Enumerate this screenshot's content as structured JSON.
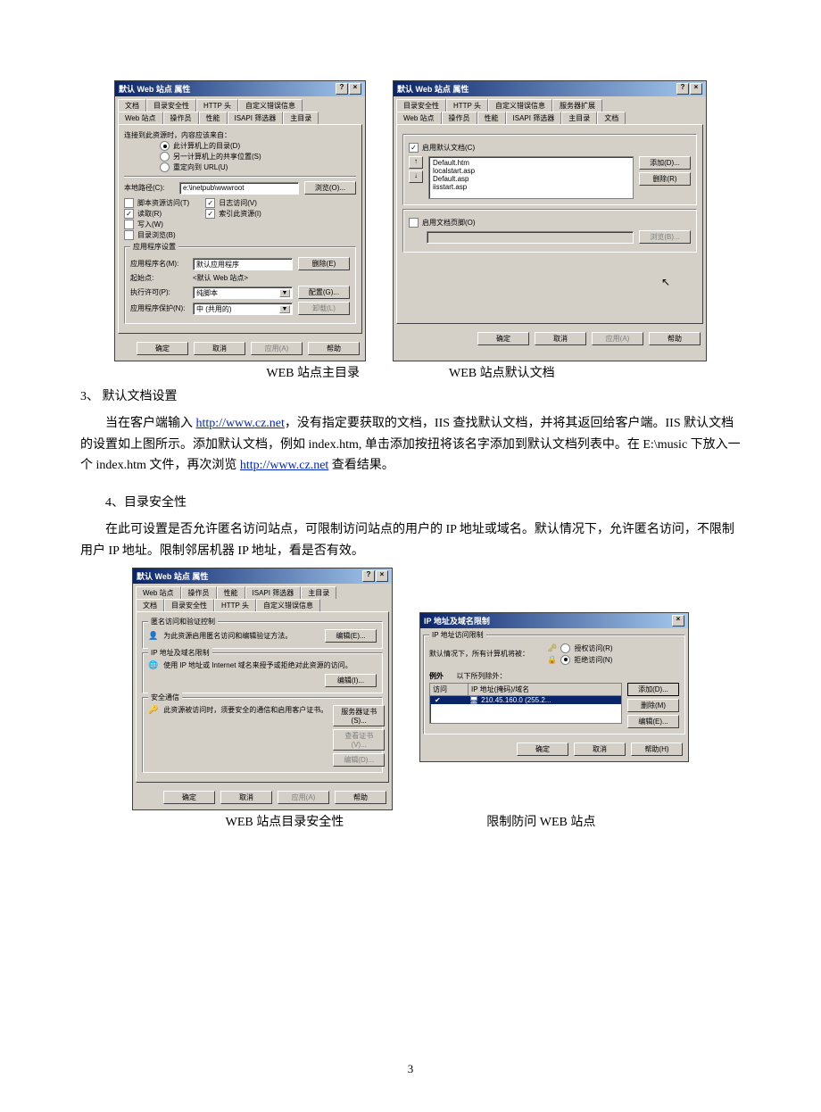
{
  "dlg1": {
    "title": "默认 Web 站点 属性",
    "tabs_row1": [
      "文档",
      "目录安全性",
      "HTTP 头",
      "自定义错误信息"
    ],
    "tabs_row2": [
      "Web 站点",
      "操作员",
      "性能",
      "ISAPI 筛选器",
      "主目录"
    ],
    "active_tab": "主目录",
    "src_legend": "连接到此资源时，内容应该来自：",
    "src_opt1": "此计算机上的目录(D)",
    "src_opt2": "另一计算机上的共享位置(S)",
    "src_opt3": "重定向到 URL(U)",
    "local_path_label": "本地路径(C):",
    "local_path_value": "e:\\inetpub\\wwwroot",
    "browse": "浏览(O)...",
    "chk_script": "脚本资源访问(T)",
    "chk_log": "日志访问(V)",
    "chk_read": "读取(R)",
    "chk_index": "索引此资源(I)",
    "chk_write": "写入(W)",
    "chk_browse": "目录浏览(B)",
    "app_legend": "应用程序设置",
    "app_name_label": "应用程序名(M):",
    "app_name_value": "默认应用程序",
    "remove": "删除(E)",
    "start_label": "起始点:",
    "start_value": "<默认 Web 站点>",
    "exec_label": "执行许可(P):",
    "exec_value": "纯脚本",
    "config": "配置(G)...",
    "protect_label": "应用程序保护(N):",
    "protect_value": "中 (共用的)",
    "unload": "卸载(L)",
    "ok": "确定",
    "cancel": "取消",
    "apply": "应用(A)",
    "help": "帮助"
  },
  "dlg2": {
    "title": "默认 Web 站点 属性",
    "tabs_row1": [
      "目录安全性",
      "HTTP 头",
      "自定义错误信息",
      "服务器扩展"
    ],
    "tabs_row2": [
      "Web 站点",
      "操作员",
      "性能",
      "ISAPI 筛选器",
      "主目录",
      "文档"
    ],
    "enable_default": "启用默认文档(C)",
    "docs": [
      "Default.htm",
      "localstart.asp",
      "Default.asp",
      "iisstart.asp"
    ],
    "add": "添加(D)...",
    "del": "删除(R)",
    "enable_footer": "启用文档页脚(O)",
    "browse": "浏览(B)...",
    "ok": "确定",
    "cancel": "取消",
    "apply": "应用(A)",
    "help": "帮助"
  },
  "dlg3": {
    "title": "默认 Web 站点 属性",
    "tabs_row1": [
      "Web 站点",
      "操作员",
      "性能",
      "ISAPI 筛选器",
      "主目录"
    ],
    "tabs_row2": [
      "文档",
      "目录安全性",
      "HTTP 头",
      "自定义错误信息"
    ],
    "anon_legend": "匿名访问和验证控制",
    "anon_text": "为此资源启用匿名访问和编辑验证方法。",
    "edit": "编辑(E)...",
    "ip_legend": "IP 地址及域名限制",
    "ip_text": "使用 IP 地址或 Internet 域名来授予或拒绝对此资源的访问。",
    "edit2": "编辑(I)...",
    "sec_legend": "安全通信",
    "sec_text": "此资源被访问时，须要安全的通信和启用客户证书。",
    "server_cert": "服务器证书(S)...",
    "view_cert": "查看证书(V)...",
    "edit3": "编辑(D)...",
    "ok": "确定",
    "cancel": "取消",
    "apply": "应用(A)",
    "help": "帮助"
  },
  "dlg4": {
    "title": "IP 地址及域名限制",
    "legend": "IP 地址访问限制",
    "default_text": "默认情况下，所有计算机将被：",
    "grant": "授权访问(R)",
    "deny": "拒绝访问(N)",
    "except": "例外",
    "except_text": "以下所列除外：",
    "col_access": "访问",
    "col_ip": "IP 地址(掩码)/域名",
    "entry": "210.45.160.0 (255.2...",
    "add": "添加(D)...",
    "del": "删除(M)",
    "edit": "编辑(E)...",
    "ok": "确定",
    "cancel": "取消",
    "help": "帮助(H)"
  },
  "captions": {
    "c1": "WEB 站点主目录",
    "c2": "WEB 站点默认文档",
    "c3": "WEB 站点目录安全性",
    "c4": "限制防问 WEB 站点"
  },
  "text": {
    "h3": "3、 默认文档设置",
    "p3a": "当在客户端输入 ",
    "url1": "http://www.cz.net",
    "p3b": "，没有指定要获取的文档，IIS 查找默认文档，并将其返回给客户端。IIS 默认文档的设置如上图所示。添加默认文档，例如 index.htm, 单击添加按扭将该名字添加到默认文档列表中。在 E:\\music 下放入一个 index.htm 文件，再次浏览 ",
    "url2": "http://www.cz.net",
    "p3c": " 查看结果。",
    "h4": "4、目录安全性",
    "p4": "在此可设置是否允许匿名访问站点，可限制访问站点的用户的 IP 地址或域名。默认情况下，允许匿名访问，不限制用户 IP 地址。限制邻居机器 IP 地址，看是否有效。",
    "pagenum": "3"
  }
}
